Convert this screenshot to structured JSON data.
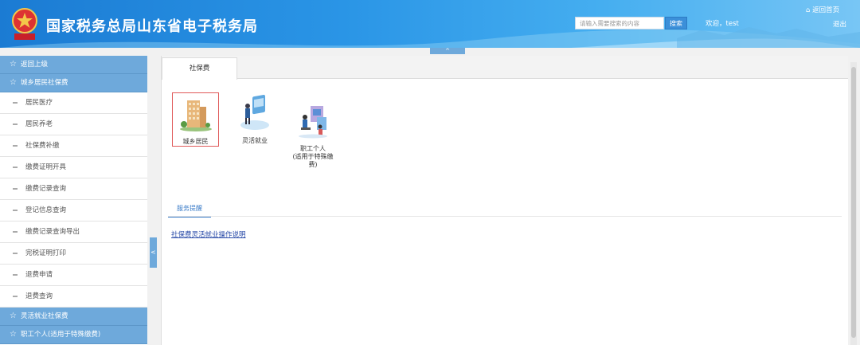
{
  "header": {
    "title": "国家税务总局山东省电子税务局",
    "search_placeholder": "请输入需要搜索的内容",
    "search_button": "搜索",
    "welcome": "欢迎，test",
    "home_link": "返回首页",
    "logout": "退出",
    "collapse_arrow": "^"
  },
  "sidebar": {
    "back": "返回上级",
    "group_urban_rural": "城乡居民社保费",
    "items": [
      {
        "label": "居民医疗"
      },
      {
        "label": "居民养老"
      },
      {
        "label": "社保费补缴"
      },
      {
        "label": "缴费证明开具"
      },
      {
        "label": "缴费记录查询"
      },
      {
        "label": "登记信息查询"
      },
      {
        "label": "缴费记录查询导出"
      },
      {
        "label": "完税证明打印"
      },
      {
        "label": "退费申请"
      },
      {
        "label": "退费查询"
      }
    ],
    "group_flexible": "灵活就业社保费",
    "group_employee": "职工个人(适用于特殊缴费)",
    "toggle": "<"
  },
  "main": {
    "tab_label": "社保费",
    "cards": [
      {
        "label": "城乡居民"
      },
      {
        "label": "灵活就业"
      },
      {
        "label": "职工个人\n(适用于特殊缴\n费)"
      }
    ],
    "notice_tab": "服务提醒",
    "notice_link": "社保费灵活就业操作说明"
  },
  "colors": {
    "header_blue": "#2a95e6",
    "sidebar_head": "#6ea9db",
    "selected_border": "#e05a5a",
    "link": "#2a4ba8"
  }
}
